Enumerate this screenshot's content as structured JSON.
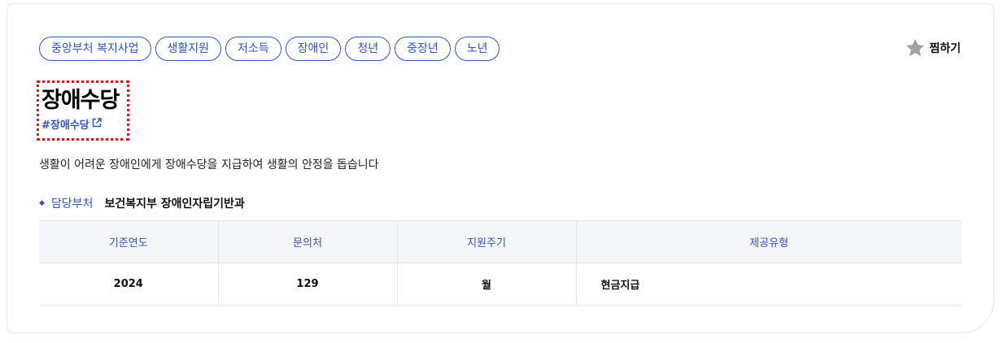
{
  "tags": [
    "중앙부처 복지사업",
    "생활지원",
    "저소득",
    "장애인",
    "청년",
    "중장년",
    "노년"
  ],
  "favorite": {
    "label": "찜하기",
    "icon": "star-icon",
    "color": "#9ea3aa"
  },
  "service": {
    "title": "장애수당",
    "hashtag": "#장애수당",
    "hashtag_icon": "external-link-icon",
    "description": "생활이 어려운 장애인에게 장애수당을 지급하여 생활의 안정을 돕습니다"
  },
  "department": {
    "label": "담당부처",
    "value": "보건복지부 장애인자립기반과"
  },
  "table": {
    "headers": [
      "기준연도",
      "문의처",
      "지원주기",
      "제공유형"
    ],
    "rows": [
      [
        "2024",
        "129",
        "월",
        "현금지급"
      ]
    ]
  },
  "colors": {
    "accent": "#2f55c8",
    "highlight_border": "#e4141b",
    "header_bg": "#f4f6fa"
  }
}
